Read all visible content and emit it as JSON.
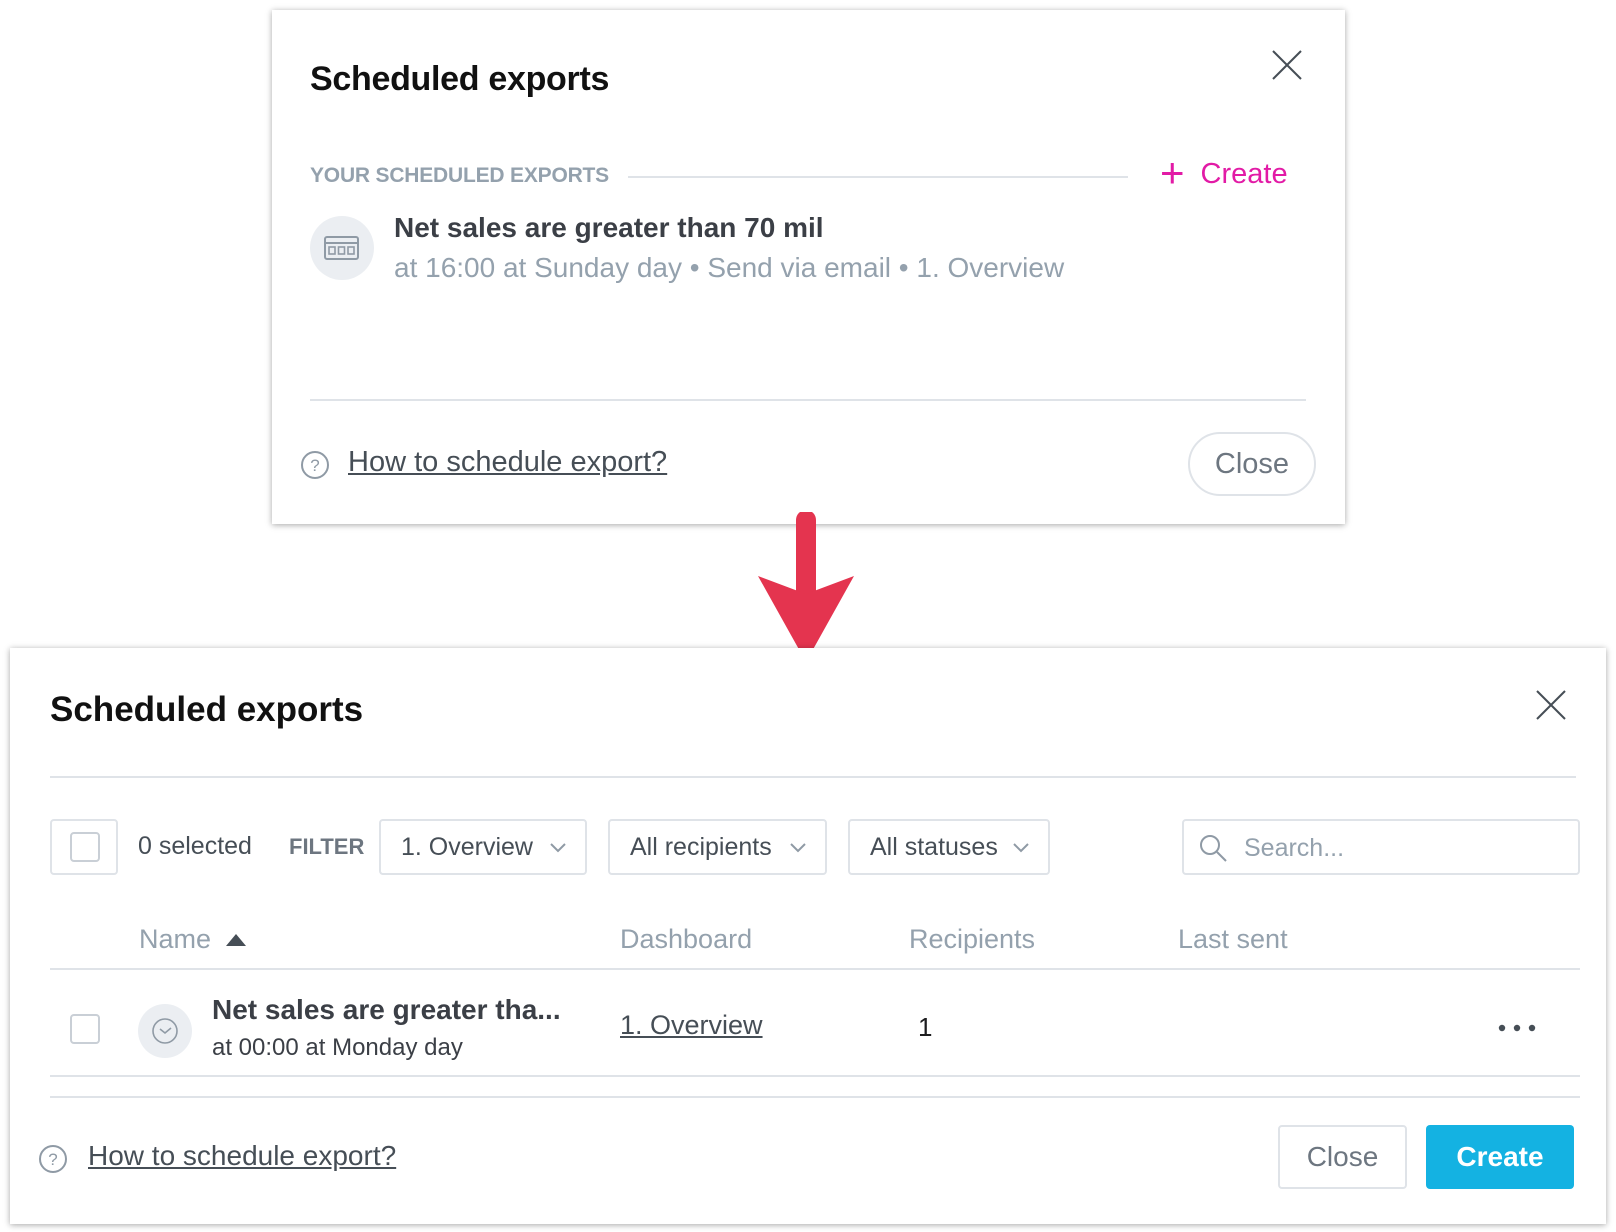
{
  "colors": {
    "accent_pink": "#e21ba6",
    "primary_blue": "#14b2e2",
    "arrow_red": "#e4344f",
    "muted_text": "#94a1ad"
  },
  "old_dialog": {
    "title": "Scheduled exports",
    "section_label": "YOUR SCHEDULED EXPORTS",
    "create_label": "Create",
    "item": {
      "icon": "dashboard-icon",
      "title": "Net sales are greater than 70 mil",
      "meta": "at 16:00 at Sunday day • Send via email • 1. Overview"
    },
    "help_label": "How to schedule export?",
    "close_label": "Close"
  },
  "new_dialog": {
    "title": "Scheduled exports",
    "selected_count": "0 selected",
    "filter_label": "FILTER",
    "filters": {
      "dashboard": "1. Overview",
      "recipients": "All recipients",
      "status": "All statuses"
    },
    "search": {
      "placeholder": "Search..."
    },
    "columns": {
      "name": "Name",
      "dashboard": "Dashboard",
      "recipients": "Recipients",
      "last_sent": "Last sent"
    },
    "rows": [
      {
        "name": "Net sales are greater tha...",
        "schedule": "at 00:00 at Monday day",
        "dashboard": "1. Overview",
        "recipients": "1",
        "last_sent": ""
      }
    ],
    "help_label": "How to schedule export?",
    "close_label": "Close",
    "create_label": "Create"
  }
}
